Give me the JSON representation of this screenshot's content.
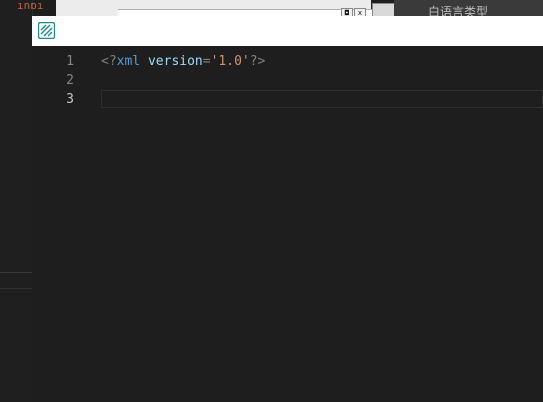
{
  "background": {
    "left_pane_code": "ınpı",
    "restore_glyph": "◘",
    "close_glyph": "x",
    "right_window_title": "白语言类型"
  },
  "editor": {
    "lines": [
      {
        "number": "1",
        "tokens": [
          "<?",
          "xml",
          " ",
          "version",
          "=",
          "'1.0'",
          "?>"
        ]
      },
      {
        "number": "2",
        "tokens": []
      },
      {
        "number": "3",
        "tokens": []
      }
    ]
  },
  "colors": {
    "editor_bg": "#1e1e1e",
    "line_number": "#858585",
    "line_number_active": "#c6c6c6",
    "punctuation": "#808080",
    "tag": "#569cd6",
    "attribute": "#9cdcfe",
    "string": "#ce9178",
    "app_icon": "#1f8a8a"
  },
  "icons": {
    "app": "editor-app-icon"
  }
}
